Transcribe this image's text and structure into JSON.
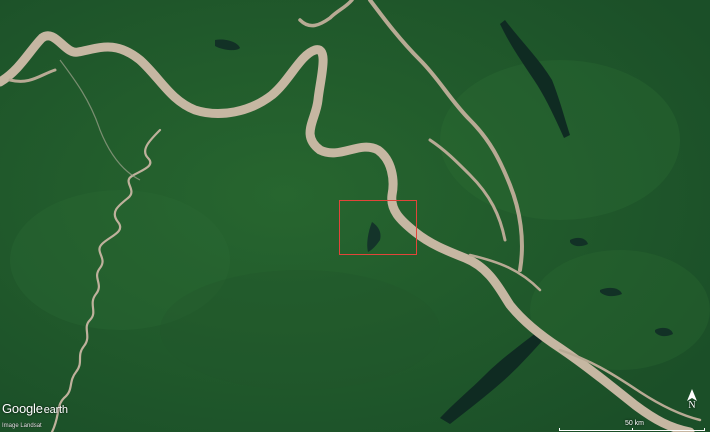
{
  "brand": {
    "logo_text": "Google",
    "logo_suffix": "earth"
  },
  "imagery_credit": "Image Landsat",
  "compass": {
    "label": "N"
  },
  "scale": {
    "label": "50 km"
  },
  "colors": {
    "forest": "#1f5a2b",
    "river": "#c6b7a2",
    "lake": "#0f2b22",
    "highlight": "#e2453a"
  },
  "highlight_box": {
    "description_visible": false
  }
}
